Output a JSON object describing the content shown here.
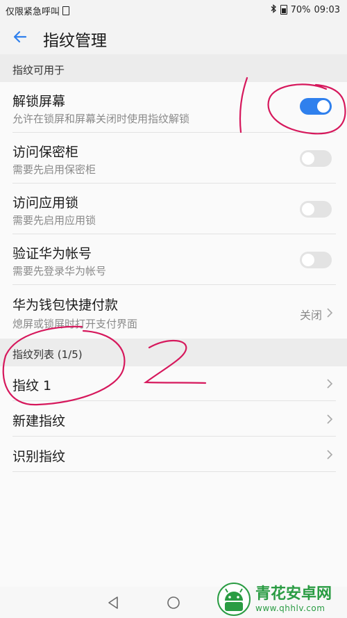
{
  "status_bar": {
    "carrier_text": "仅限紧急呼叫",
    "battery_text": "70%",
    "time": "09:03"
  },
  "header": {
    "title": "指纹管理",
    "back_icon": "arrow-left-icon"
  },
  "sections": {
    "usage_header": "指纹可用于",
    "list_header": "指纹列表 (1/5)"
  },
  "settings": {
    "unlock": {
      "title": "解锁屏幕",
      "subtitle": "允许在锁屏和屏幕关闭时使用指纹解锁",
      "enabled": true
    },
    "safe": {
      "title": "访问保密柜",
      "subtitle": "需要先启用保密柜",
      "enabled": false
    },
    "applock": {
      "title": "访问应用锁",
      "subtitle": "需要先启用应用锁",
      "enabled": false
    },
    "huawei_id": {
      "title": "验证华为帐号",
      "subtitle": "需要先登录华为帐号",
      "enabled": false
    },
    "wallet": {
      "title": "华为钱包快捷付款",
      "subtitle": "熄屏或锁屏时打开支付界面",
      "value": "关闭"
    }
  },
  "fingerprints": {
    "items": [
      {
        "label": "指纹 1"
      }
    ],
    "new_label": "新建指纹",
    "identify_label": "识别指纹"
  },
  "annotations": {
    "mark_1": "1",
    "mark_2": "2"
  },
  "watermark": {
    "name": "青花安卓网",
    "url": "www.qhhlv.com"
  },
  "colors": {
    "accent": "#2f80ed",
    "annotation": "#d6185c",
    "watermark": "#2a9c43"
  }
}
